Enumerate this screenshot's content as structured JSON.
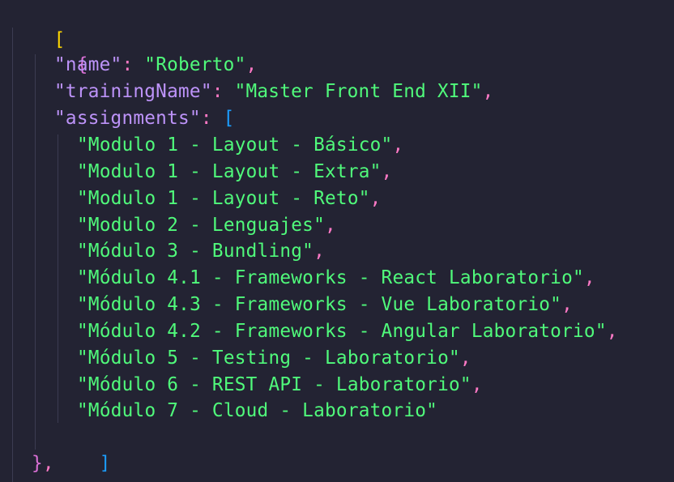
{
  "colors": {
    "background": "#232333",
    "key": "#bd93f9",
    "string": "#50fa7b",
    "punctuation": "#ff79c6",
    "bracket_level1": "#ffd700",
    "bracket_level2": "#da70d6",
    "bracket_level3": "#1b9dff"
  },
  "code": {
    "open_array": "[",
    "open_object": "{",
    "name_key": "\"name\"",
    "name_value": "\"Roberto\"",
    "training_key": "\"trainingName\"",
    "training_value": "\"Master Front End XII\"",
    "assignments_key": "\"assignments\"",
    "open_assignments": "[",
    "assignments": [
      "\"Modulo 1 - Layout - Básico\"",
      "\"Modulo 1 - Layout - Extra\"",
      "\"Modulo 1 - Layout - Reto\"",
      "\"Modulo 2 - Lenguajes\"",
      "\"Módulo 3 - Bundling\"",
      "\"Módulo 4.1 - Frameworks - React Laboratorio\"",
      "\"Módulo 4.3 - Frameworks - Vue Laboratorio\"",
      "\"Módulo 4.2 - Frameworks - Angular Laboratorio\"",
      "\"Módulo 5 - Testing - Laboratorio\"",
      "\"Módulo 6 - REST API - Laboratorio\"",
      "\"Módulo 7 - Cloud - Laboratorio\""
    ],
    "close_assignments": "]",
    "close_object": "}",
    "colon": ": ",
    "comma": ","
  }
}
